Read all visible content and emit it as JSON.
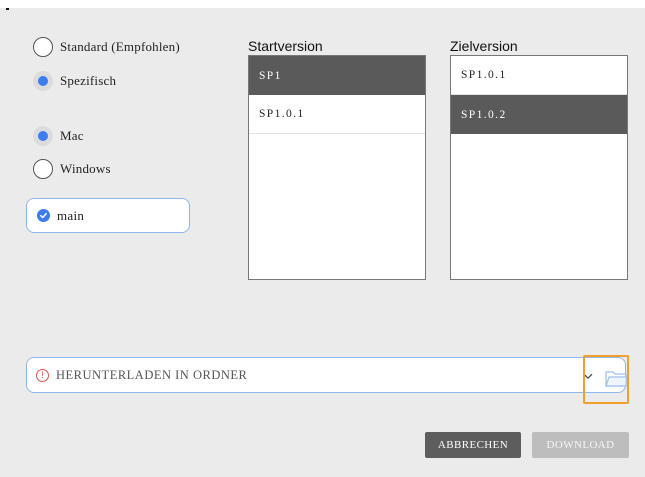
{
  "mode": {
    "options": [
      {
        "label": "Standard (Empfohlen)",
        "selected": false
      },
      {
        "label": "Spezifisch",
        "selected": true
      }
    ]
  },
  "platform": {
    "options": [
      {
        "label": "Mac",
        "selected": true
      },
      {
        "label": "Windows",
        "selected": false
      }
    ]
  },
  "branch": {
    "label": "main",
    "checked": true
  },
  "start_version": {
    "title": "Startversion",
    "items": [
      {
        "label": "SP1",
        "selected": true
      },
      {
        "label": "SP1.0.1",
        "selected": false
      }
    ]
  },
  "target_version": {
    "title": "Zielversion",
    "items": [
      {
        "label": "SP1.0.1",
        "selected": false
      },
      {
        "label": "SP1.0.2",
        "selected": true
      }
    ]
  },
  "download_folder": {
    "placeholder": "HERUNTERLADEN IN ORDNER",
    "warning_icon": "exclamation-circle-icon",
    "dropdown_icon": "chevron-down-icon",
    "browse_icon": "folder-icon"
  },
  "buttons": {
    "cancel": "ABBRECHEN",
    "download": "DOWNLOAD"
  },
  "colors": {
    "accent": "#3b7df0",
    "selected_row": "#5a5a5a",
    "focus_outline": "#f0a028",
    "warning": "#d9534f"
  }
}
